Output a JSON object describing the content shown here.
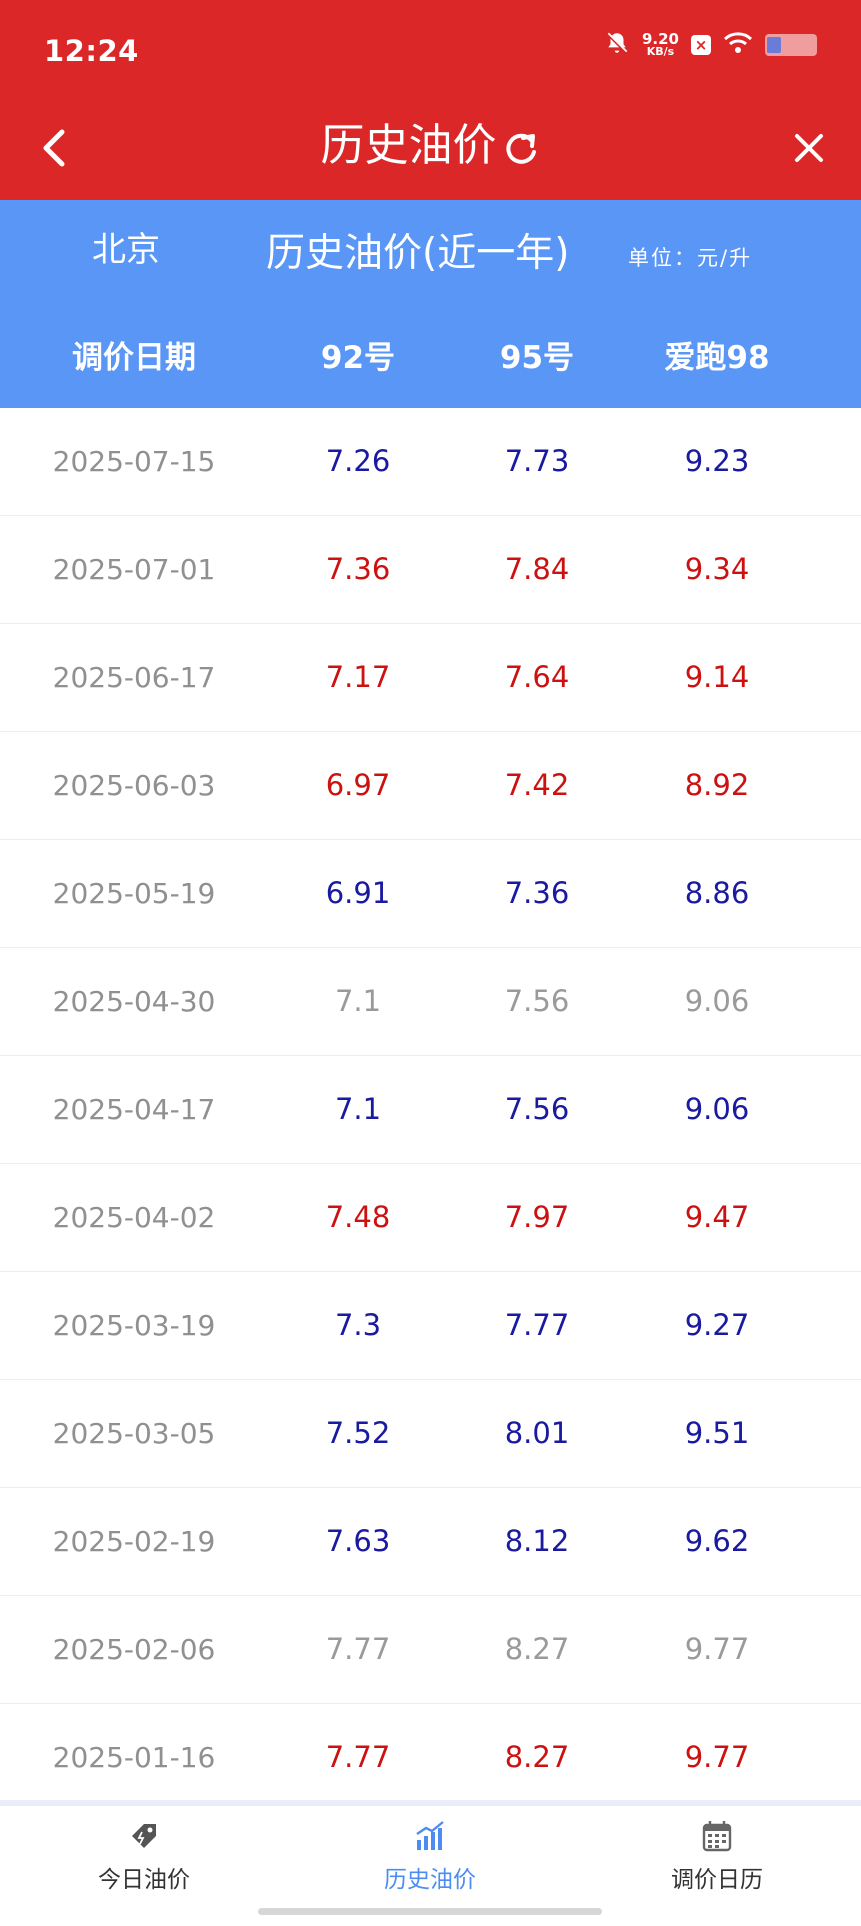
{
  "status_bar": {
    "time": "12:24",
    "net_speed": "9.20",
    "net_unit": "KB/s"
  },
  "nav": {
    "title": "历史油价"
  },
  "header": {
    "city": "北京",
    "title": "历史油价(近一年)",
    "unit": "单位：元/升",
    "columns": [
      "调价日期",
      "92号",
      "95号",
      "爱跑98"
    ]
  },
  "colors": {
    "up": "#cc1111",
    "down": "#1a1aa0",
    "same": "#9a9a9a",
    "accent": "#db2727",
    "header_bg": "#5a96f5",
    "tab_active": "#4d8cf0",
    "tab_inactive": "#333333"
  },
  "rows": [
    {
      "date": "2025-07-15",
      "p92": "7.26",
      "p95": "7.73",
      "p98": "9.23",
      "trend": "down"
    },
    {
      "date": "2025-07-01",
      "p92": "7.36",
      "p95": "7.84",
      "p98": "9.34",
      "trend": "up"
    },
    {
      "date": "2025-06-17",
      "p92": "7.17",
      "p95": "7.64",
      "p98": "9.14",
      "trend": "up"
    },
    {
      "date": "2025-06-03",
      "p92": "6.97",
      "p95": "7.42",
      "p98": "8.92",
      "trend": "up"
    },
    {
      "date": "2025-05-19",
      "p92": "6.91",
      "p95": "7.36",
      "p98": "8.86",
      "trend": "down"
    },
    {
      "date": "2025-04-30",
      "p92": "7.1",
      "p95": "7.56",
      "p98": "9.06",
      "trend": "same"
    },
    {
      "date": "2025-04-17",
      "p92": "7.1",
      "p95": "7.56",
      "p98": "9.06",
      "trend": "down"
    },
    {
      "date": "2025-04-02",
      "p92": "7.48",
      "p95": "7.97",
      "p98": "9.47",
      "trend": "up"
    },
    {
      "date": "2025-03-19",
      "p92": "7.3",
      "p95": "7.77",
      "p98": "9.27",
      "trend": "down"
    },
    {
      "date": "2025-03-05",
      "p92": "7.52",
      "p95": "8.01",
      "p98": "9.51",
      "trend": "down"
    },
    {
      "date": "2025-02-19",
      "p92": "7.63",
      "p95": "8.12",
      "p98": "9.62",
      "trend": "down"
    },
    {
      "date": "2025-02-06",
      "p92": "7.77",
      "p95": "8.27",
      "p98": "9.77",
      "trend": "same"
    },
    {
      "date": "2025-01-16",
      "p92": "7.77",
      "p95": "8.27",
      "p98": "9.77",
      "trend": "up"
    }
  ],
  "tabs": [
    {
      "label": "今日油价",
      "icon": "price-tag-icon",
      "active": false
    },
    {
      "label": "历史油价",
      "icon": "bar-chart-icon",
      "active": true
    },
    {
      "label": "调价日历",
      "icon": "calendar-icon",
      "active": false
    }
  ]
}
